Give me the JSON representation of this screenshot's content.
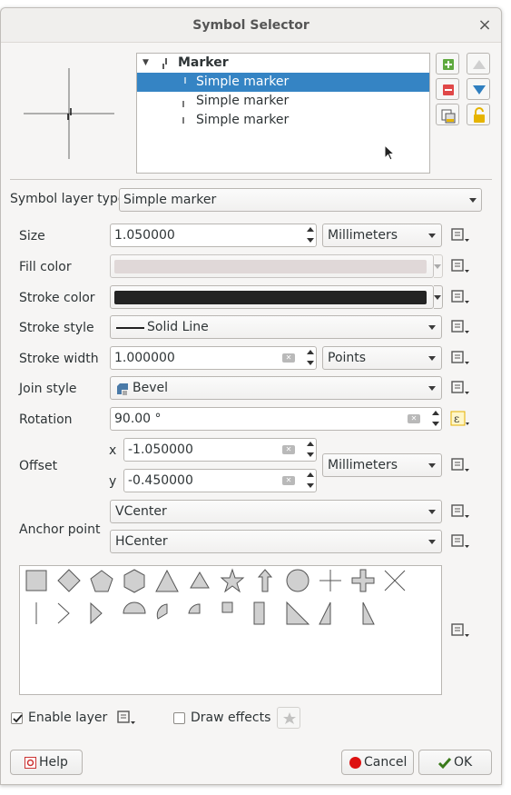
{
  "window": {
    "title": "Symbol Selector",
    "close_glyph": "×"
  },
  "tree": {
    "root": "Marker",
    "items": [
      "Simple marker",
      "Simple marker",
      "Simple marker"
    ],
    "selected_index": 0
  },
  "symbol_layer_type": {
    "label": "Symbol layer type",
    "value": "Simple marker"
  },
  "props": {
    "size": {
      "label": "Size",
      "value": "1.050000",
      "unit": "Millimeters"
    },
    "fill_color": {
      "label": "Fill color",
      "color": "#d9cfcf"
    },
    "stroke_color": {
      "label": "Stroke color",
      "color": "#232323"
    },
    "stroke_style": {
      "label": "Stroke style",
      "value": "Solid Line"
    },
    "stroke_width": {
      "label": "Stroke width",
      "value": "1.000000",
      "unit": "Points"
    },
    "join_style": {
      "label": "Join style",
      "value": "Bevel"
    },
    "rotation": {
      "label": "Rotation",
      "value": "90.00 °"
    },
    "offset": {
      "label": "Offset",
      "x_label": "x",
      "x": "-1.050000",
      "y_label": "y",
      "y": "-0.450000",
      "unit": "Millimeters"
    },
    "anchor_point": {
      "label": "Anchor point",
      "vertical": "VCenter",
      "horizontal": "HCenter"
    }
  },
  "shapes": [
    "square",
    "diamond",
    "pentagon",
    "hexagon",
    "triangle",
    "equilateral-triangle",
    "star",
    "arrow",
    "circle",
    "cross",
    "cross-fill",
    "cross2",
    "line",
    "arrowhead",
    "filled-arrowhead",
    "semi-circle",
    "third-circle",
    "quarter-circle",
    "quarter-square",
    "half-square",
    "diagonal-half-square",
    "right-half-triangle",
    "left-half-triangle"
  ],
  "footer": {
    "enable_layer": {
      "label": "Enable layer",
      "checked": true
    },
    "draw_effects": {
      "label": "Draw effects",
      "checked": false
    },
    "help_label": "Help",
    "cancel_label": "Cancel",
    "ok_label": "OK"
  },
  "colors": {
    "selection": "#3584c4",
    "expression_active": "#e5b100"
  }
}
